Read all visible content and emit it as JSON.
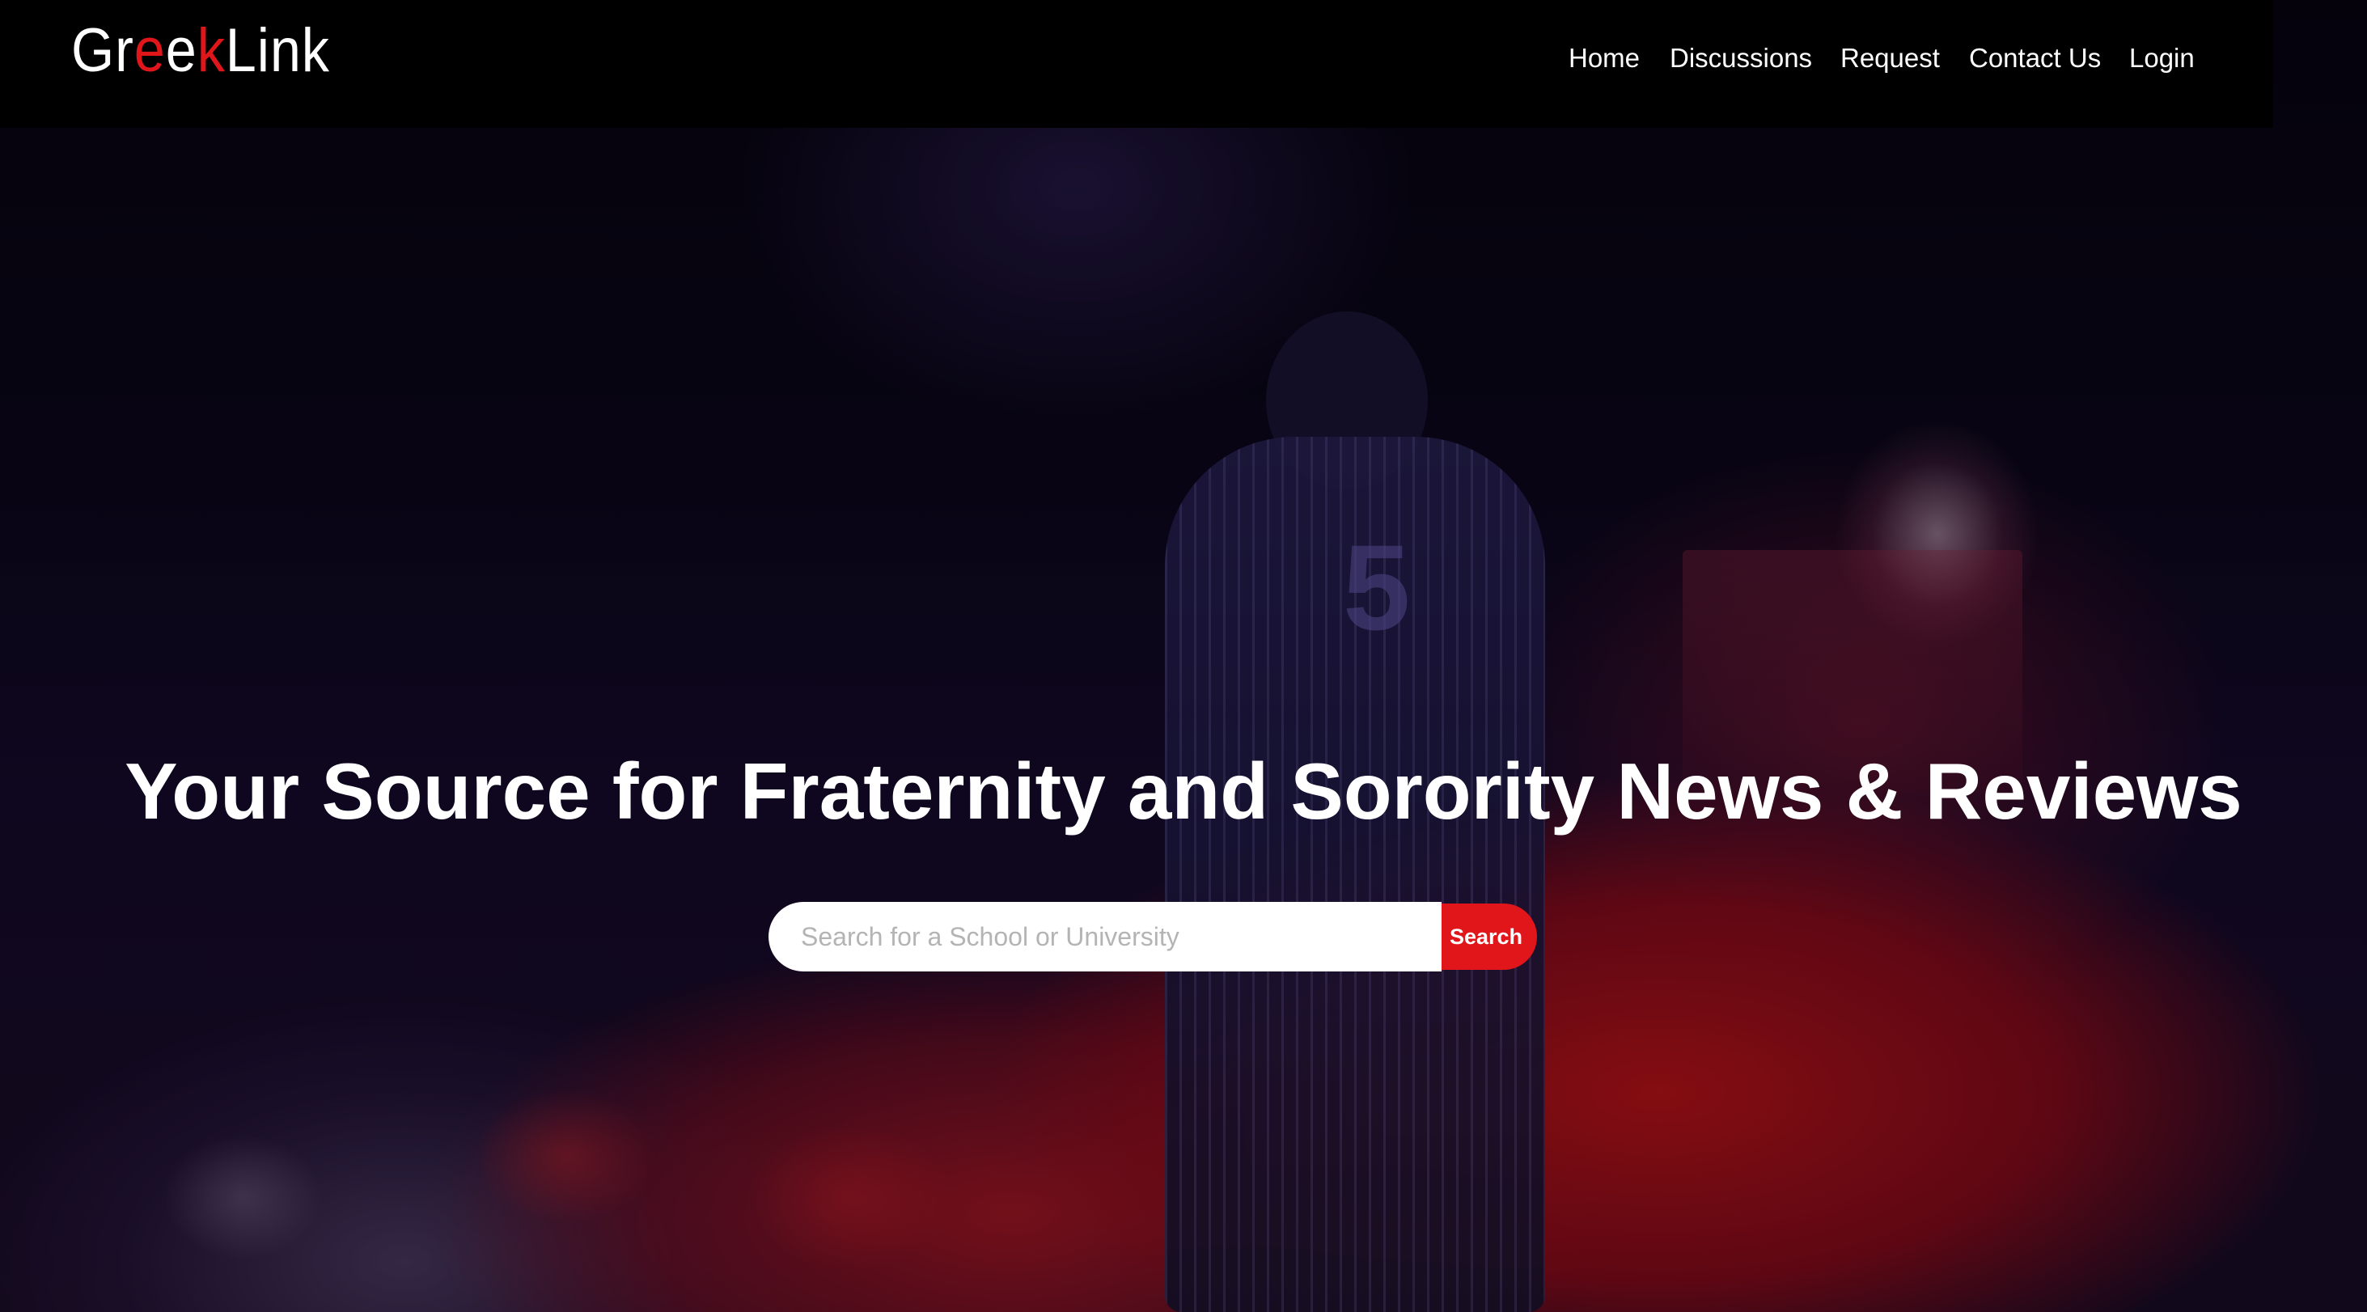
{
  "navbar": {
    "logo": {
      "part1": "Gr",
      "part2": "e",
      "part3": "e",
      "part4": "k",
      "part5": "Link"
    },
    "links": [
      {
        "label": "Home"
      },
      {
        "label": "Discussions"
      },
      {
        "label": "Request"
      },
      {
        "label": "Contact Us"
      },
      {
        "label": "Login"
      }
    ]
  },
  "hero": {
    "title": "Your Source for Fraternity and Sorority News & Reviews",
    "jersey_number": "5",
    "search": {
      "placeholder": "Search for a School or University",
      "value": "",
      "button_label": "Search"
    }
  },
  "colors": {
    "accent": "#e0161b",
    "navbar_bg": "#000000",
    "text_primary": "#ffffff"
  }
}
